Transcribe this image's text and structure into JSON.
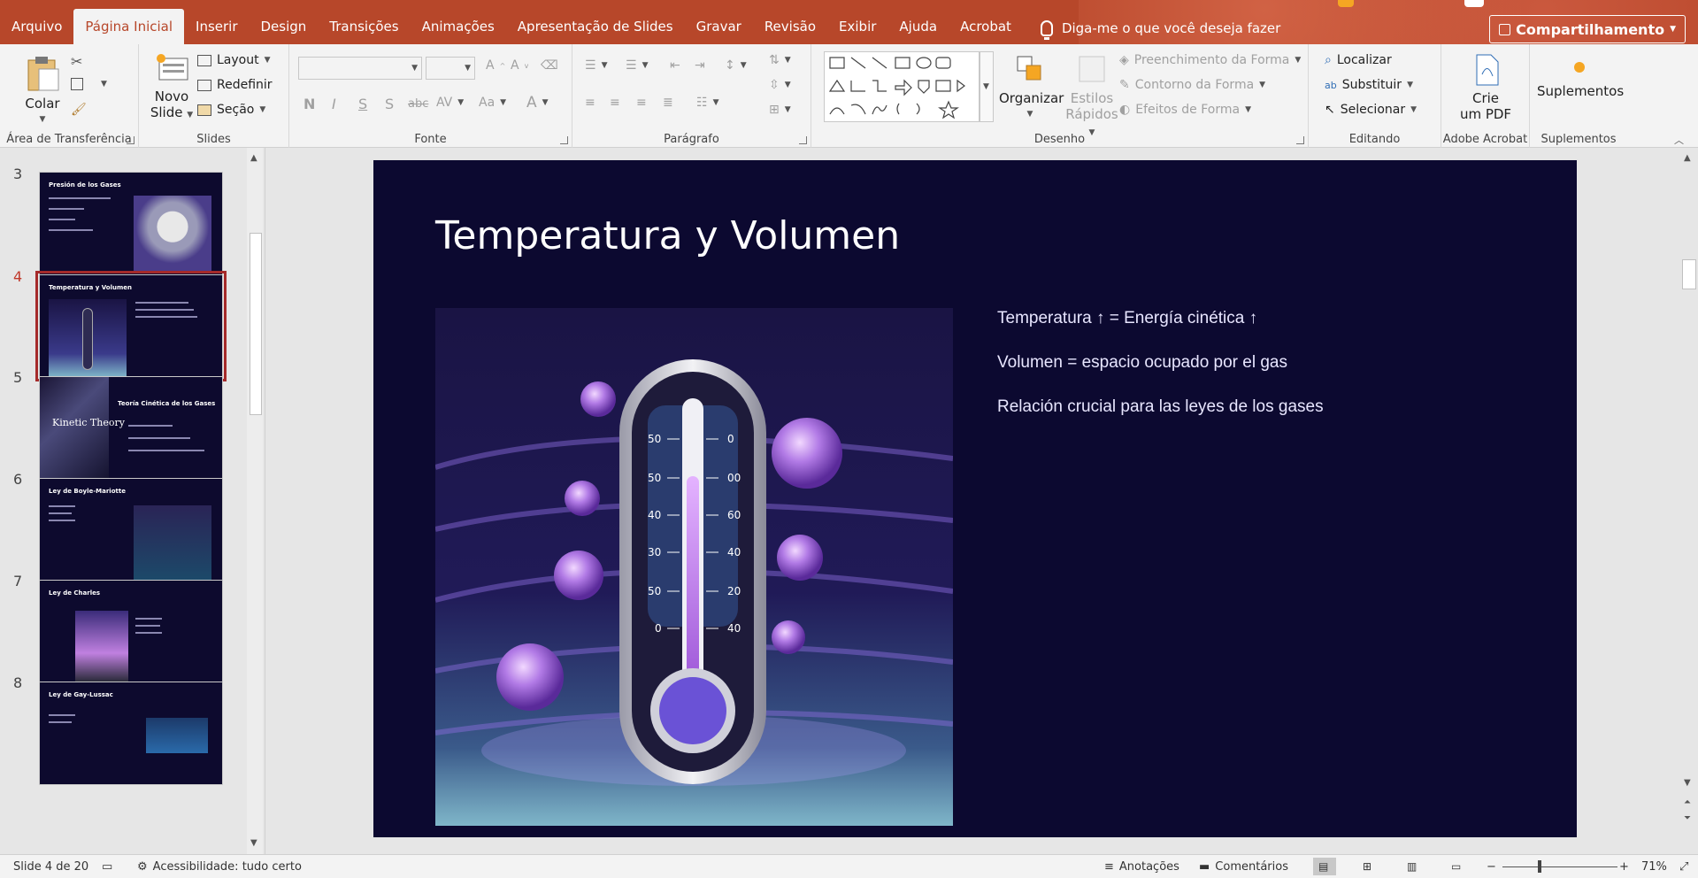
{
  "tabs": [
    "Arquivo",
    "Página Inicial",
    "Inserir",
    "Design",
    "Transições",
    "Animações",
    "Apresentação de Slides",
    "Gravar",
    "Revisão",
    "Exibir",
    "Ajuda",
    "Acrobat"
  ],
  "tell_me": "Diga-me o que você deseja fazer",
  "share": "Compartilhamento",
  "ribbon": {
    "clipboard": {
      "paste": "Colar",
      "label": "Área de Transferência"
    },
    "slides": {
      "new_slide_1": "Novo",
      "new_slide_2": "Slide",
      "layout": "Layout",
      "reset": "Redefinir",
      "section": "Seção",
      "label": "Slides"
    },
    "font": {
      "bold": "N",
      "italic": "I",
      "underline": "S",
      "shadow": "S",
      "strike": "abc",
      "spacing": "AV",
      "case": "Aa",
      "color": "A",
      "label": "Fonte"
    },
    "paragraph": {
      "label": "Parágrafo"
    },
    "drawing": {
      "arrange": "Organizar",
      "styles_1": "Estilos",
      "styles_2": "Rápidos",
      "fill": "Preenchimento da Forma",
      "outline": "Contorno da Forma",
      "effects": "Efeitos de Forma",
      "label": "Desenho"
    },
    "editing": {
      "find": "Localizar",
      "replace": "Substituir",
      "select": "Selecionar",
      "label": "Editando"
    },
    "acrobat": {
      "create_1": "Crie",
      "create_2": "um PDF",
      "label": "Adobe Acrobat"
    },
    "addins": {
      "addins": "Suplementos",
      "label": "Suplementos"
    }
  },
  "thumbnails": [
    {
      "num": "3",
      "title": "Presión de los Gases"
    },
    {
      "num": "4",
      "title": "Temperatura y Volumen"
    },
    {
      "num": "5",
      "title": "Teoría Cinética de los Gases",
      "side": "Kinetic Theory"
    },
    {
      "num": "6",
      "title": "Ley de Boyle-Mariotte"
    },
    {
      "num": "7",
      "title": "Ley de Charles"
    },
    {
      "num": "8",
      "title": "Ley de Gay-Lussac"
    }
  ],
  "slide": {
    "title": "Temperatura y Volumen",
    "bullets": [
      "Temperatura ↑ = Energía cinética ↑",
      "Volumen = espacio ocupado por el gas",
      "Relación crucial para las leyes de los gases"
    ],
    "thermo_left_scale": [
      "50",
      "50",
      "40",
      "30",
      "50",
      "0"
    ],
    "thermo_right_scale": [
      "0",
      "00",
      "60",
      "40",
      "20",
      "40"
    ]
  },
  "status": {
    "slide_counter": "Slide 4 de 20",
    "accessibility": "Acessibilidade: tudo certo",
    "notes": "Anotações",
    "comments": "Comentários",
    "zoom": "71%"
  },
  "colors": {
    "accent": "#b7472a",
    "slide_bg": "#0c0930",
    "selected_thumb": "#a52a2a"
  }
}
